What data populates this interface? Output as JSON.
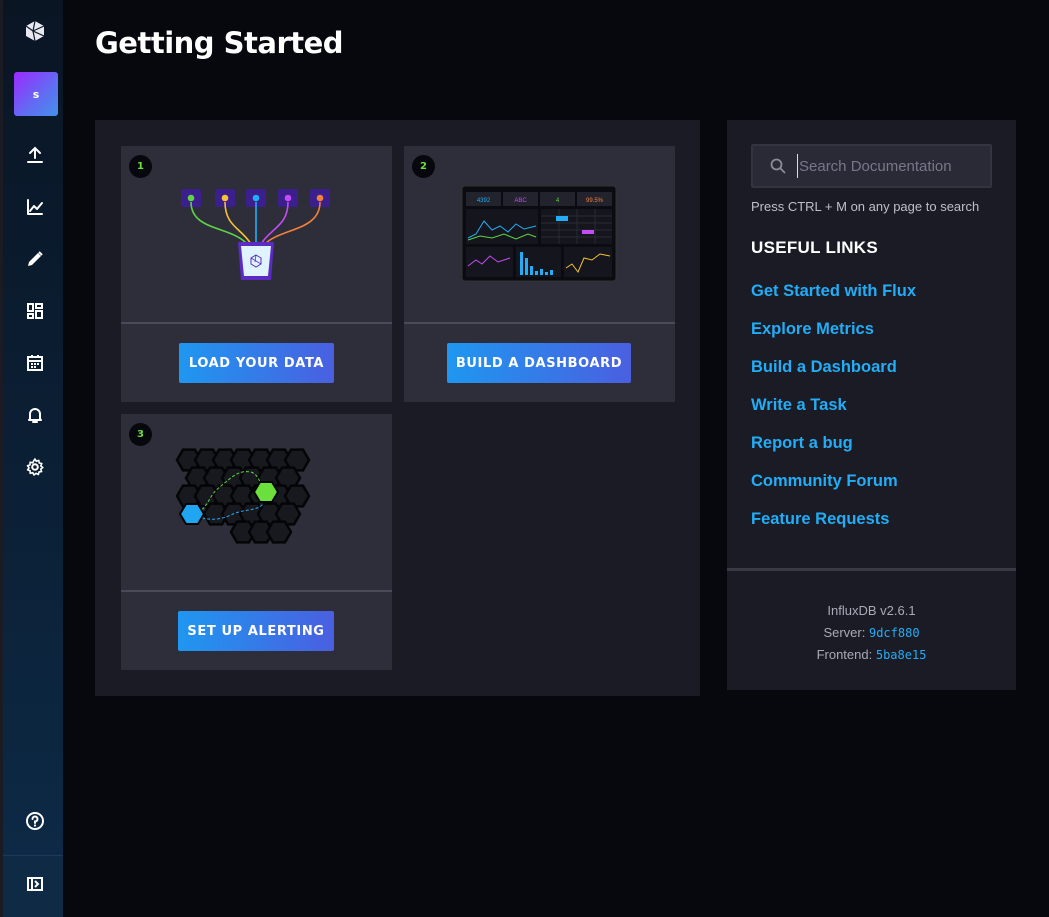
{
  "page": {
    "title": "Getting Started"
  },
  "sidebar": {
    "org_initial": "s",
    "items": [
      {
        "icon": "upload-icon"
      },
      {
        "icon": "graph-icon"
      },
      {
        "icon": "pencil-icon"
      },
      {
        "icon": "dashboards-icon"
      },
      {
        "icon": "calendar-icon"
      },
      {
        "icon": "bell-icon"
      },
      {
        "icon": "gear-icon"
      }
    ],
    "bottom": [
      {
        "icon": "help-icon"
      },
      {
        "icon": "collapse-icon"
      }
    ]
  },
  "cards": [
    {
      "number": "1",
      "button": "LOAD YOUR DATA"
    },
    {
      "number": "2",
      "button": "BUILD A DASHBOARD"
    },
    {
      "number": "3",
      "button": "SET UP ALERTING"
    }
  ],
  "dashboard_preview": {
    "stats": [
      "4392",
      "ABC",
      "4",
      "99.5%"
    ]
  },
  "search": {
    "placeholder": "Search Documentation",
    "hint": "Press CTRL + M on any page to search"
  },
  "useful_links": {
    "title": "USEFUL LINKS",
    "items": [
      "Get Started with Flux",
      "Explore Metrics",
      "Build a Dashboard",
      "Write a Task",
      "Report a bug",
      "Community Forum",
      "Feature Requests"
    ]
  },
  "version": {
    "product": "InfluxDB v2.6.1",
    "server_label": "Server:",
    "server_hash": "9dcf880",
    "frontend_label": "Frontend:",
    "frontend_hash": "5ba8e15"
  },
  "colors": {
    "accent_blue": "#22adf6",
    "accent_green": "#6bdf3c",
    "button_start": "#1f97f0",
    "button_end": "#4a5fe0",
    "avatar_purple": "#9b2aff"
  }
}
